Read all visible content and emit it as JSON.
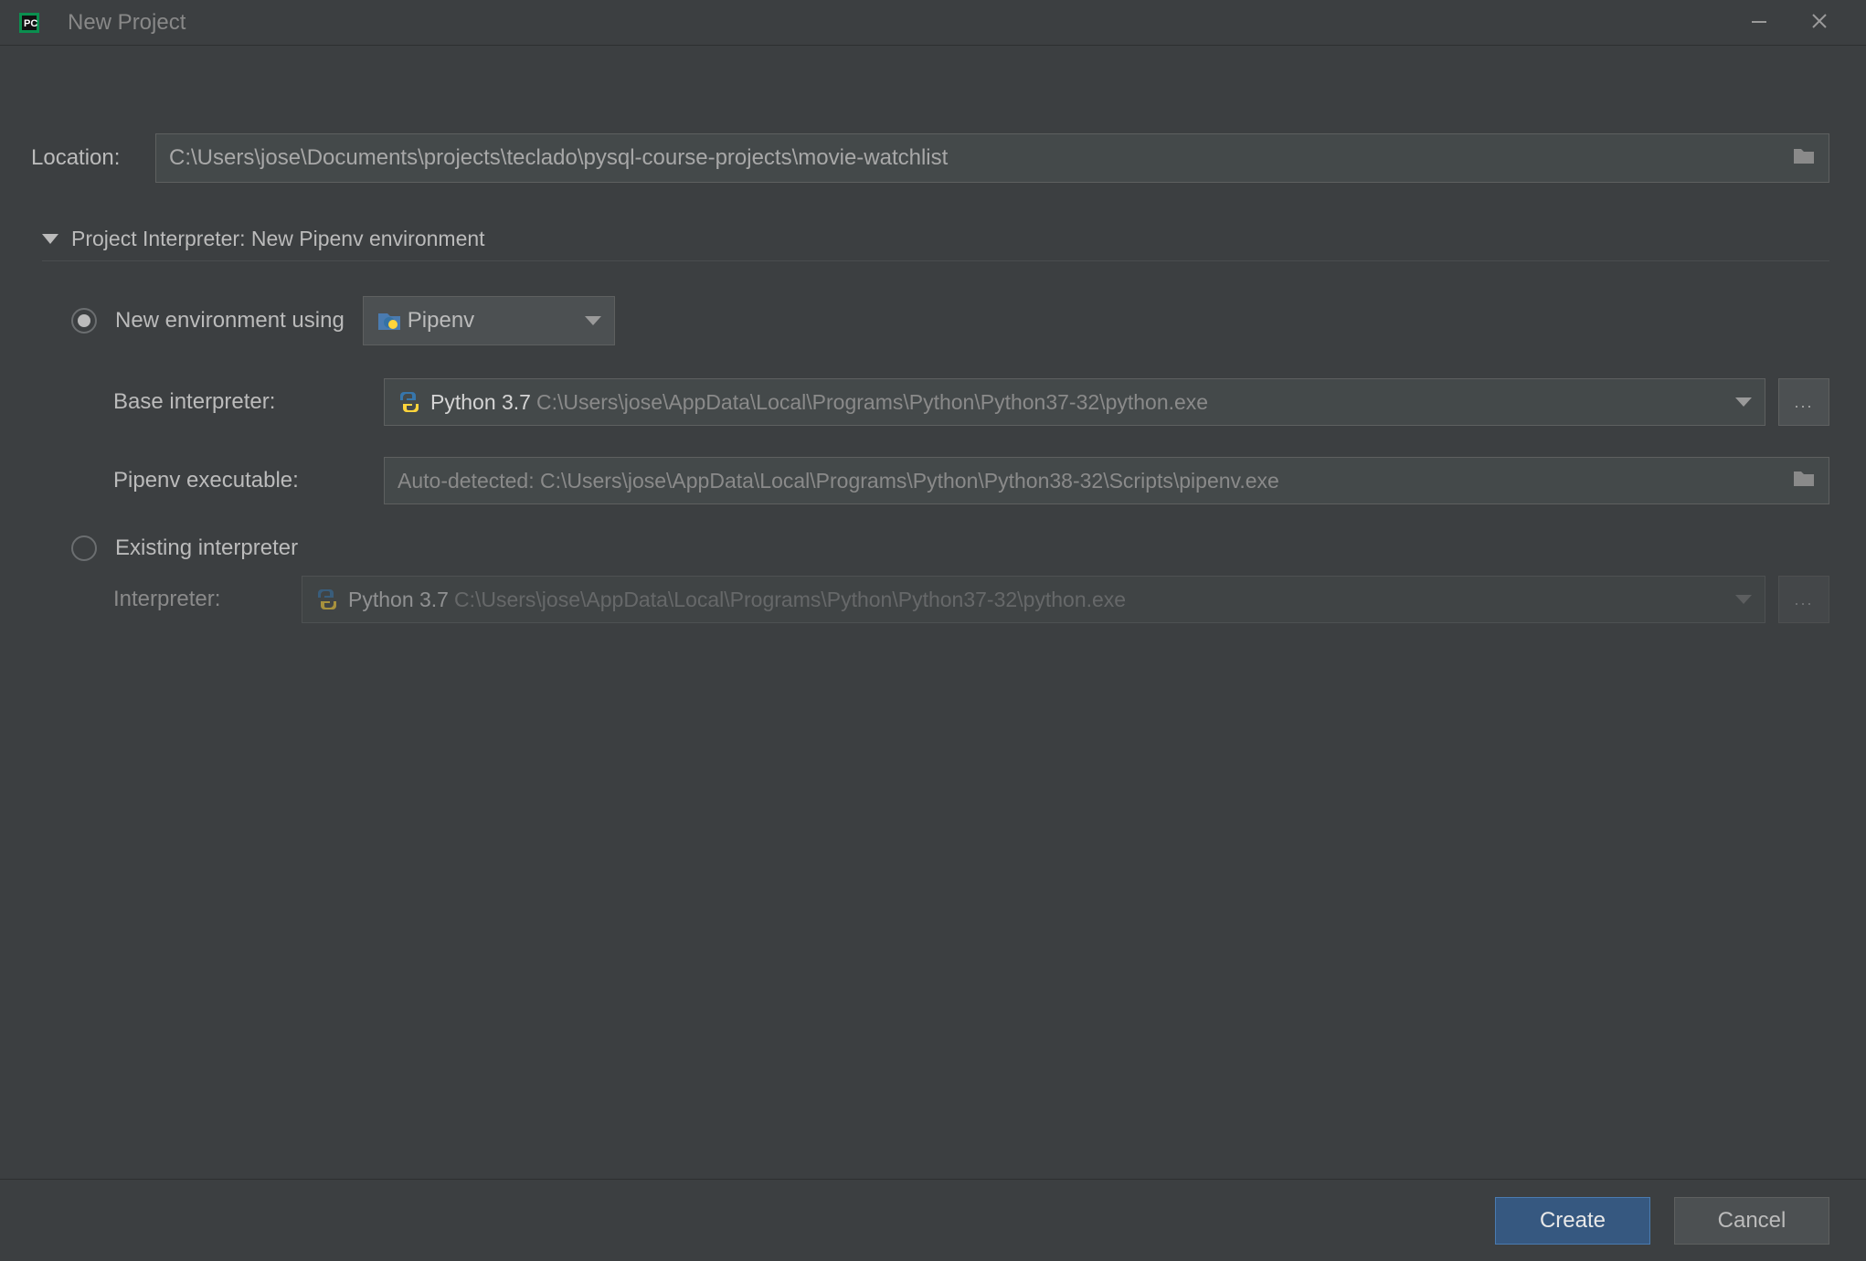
{
  "window": {
    "title": "New Project"
  },
  "location": {
    "label": "Location:",
    "value": "C:\\Users\\jose\\Documents\\projects\\teclado\\pysql-course-projects\\movie-watchlist"
  },
  "interpreter_section": {
    "title": "Project Interpreter: New Pipenv environment"
  },
  "new_env": {
    "radio_label": "New environment using",
    "tool": "Pipenv",
    "base_interpreter_label": "Base interpreter:",
    "base_interpreter_primary": "Python 3.7",
    "base_interpreter_path": "C:\\Users\\jose\\AppData\\Local\\Programs\\Python\\Python37-32\\python.exe",
    "pipenv_exe_label": "Pipenv executable:",
    "pipenv_exe_placeholder": "Auto-detected: C:\\Users\\jose\\AppData\\Local\\Programs\\Python\\Python38-32\\Scripts\\pipenv.exe"
  },
  "existing": {
    "radio_label": "Existing interpreter",
    "interpreter_label": "Interpreter:",
    "interpreter_primary": "Python 3.7",
    "interpreter_path": "C:\\Users\\jose\\AppData\\Local\\Programs\\Python\\Python37-32\\python.exe"
  },
  "footer": {
    "create": "Create",
    "cancel": "Cancel"
  },
  "ellipsis": "..."
}
